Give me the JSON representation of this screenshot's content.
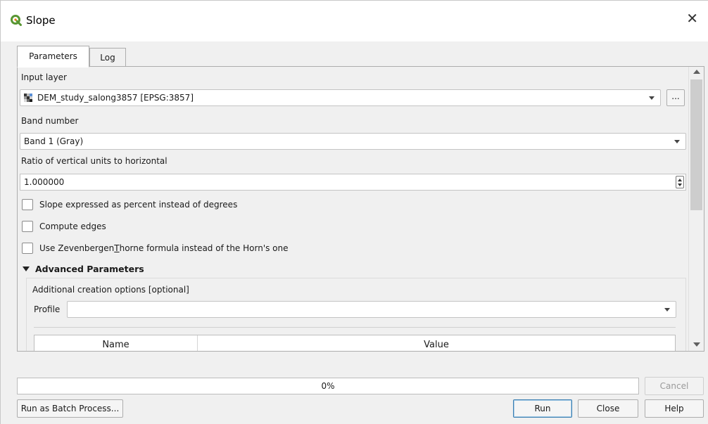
{
  "window": {
    "title": "Slope",
    "close_glyph": "✕",
    "logo_icon": "qgis-logo-icon",
    "accent": "#589632"
  },
  "tabs": [
    {
      "label": "Parameters",
      "active": true
    },
    {
      "label": "Log",
      "active": false
    }
  ],
  "params": {
    "input_layer_label": "Input layer",
    "input_layer_value": "DEM_study_salong3857 [EPSG:3857]",
    "input_layer_icon": "raster-layer-icon",
    "browse_label": "...",
    "band_label": "Band number",
    "band_value": "Band 1 (Gray)",
    "ratio_label": "Ratio of vertical units to horizontal",
    "ratio_value": "1.000000",
    "checkbox_percent": {
      "label": "Slope expressed as percent instead of degrees",
      "checked": false
    },
    "checkbox_edges": {
      "label": "Compute edges",
      "checked": false
    },
    "checkbox_zevenbergen": {
      "label_prefix": "Use Zevenbergen",
      "label_mnemonic": "T",
      "label_suffix": "horne formula instead of the Horn's one",
      "checked": false
    },
    "advanced_header": "Advanced Parameters",
    "creation_options_label": "Additional creation options [optional]",
    "profile_label": "Profile",
    "profile_value": "",
    "table_columns": [
      "Name",
      "Value"
    ]
  },
  "footer": {
    "progress_text": "0%",
    "progress_value": 0,
    "cancel_label": "Cancel",
    "batch_label": "Run as Batch Process...",
    "run_label": "Run",
    "close_label": "Close",
    "help_label": "Help"
  }
}
